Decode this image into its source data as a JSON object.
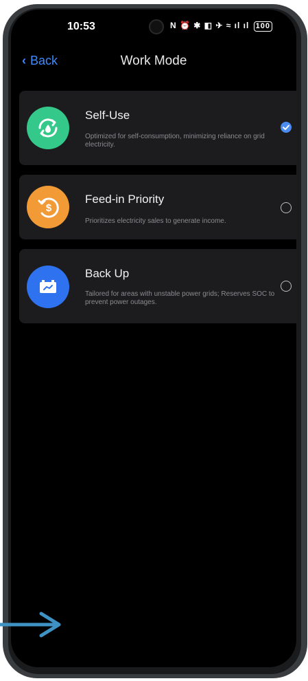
{
  "status_bar": {
    "time": "10:53",
    "icons": "N ⏰ ✱ ◧ ✈ ≈ ıl ıl",
    "battery": "100"
  },
  "nav": {
    "back_label": "Back",
    "title": "Work Mode"
  },
  "modes": [
    {
      "name": "Self-Use",
      "description": "Optimized for self-consumption, minimizing reliance on grid electricity.",
      "selected": true,
      "icon": "self-use-icon",
      "color": "#34c98a"
    },
    {
      "name": "Feed-in Priority",
      "description": "Prioritizes electricity sales to generate income.",
      "selected": false,
      "icon": "dollar-icon",
      "color": "#f29a36"
    },
    {
      "name": "Back Up",
      "description": "Tailored for areas with unstable power grids; Reserves SOC to prevent power outages.",
      "selected": false,
      "icon": "battery-plug-icon",
      "color": "#2f72f0"
    }
  ],
  "colors": {
    "accent": "#3d8bff",
    "annotation_arrow": "#3e93c4"
  }
}
